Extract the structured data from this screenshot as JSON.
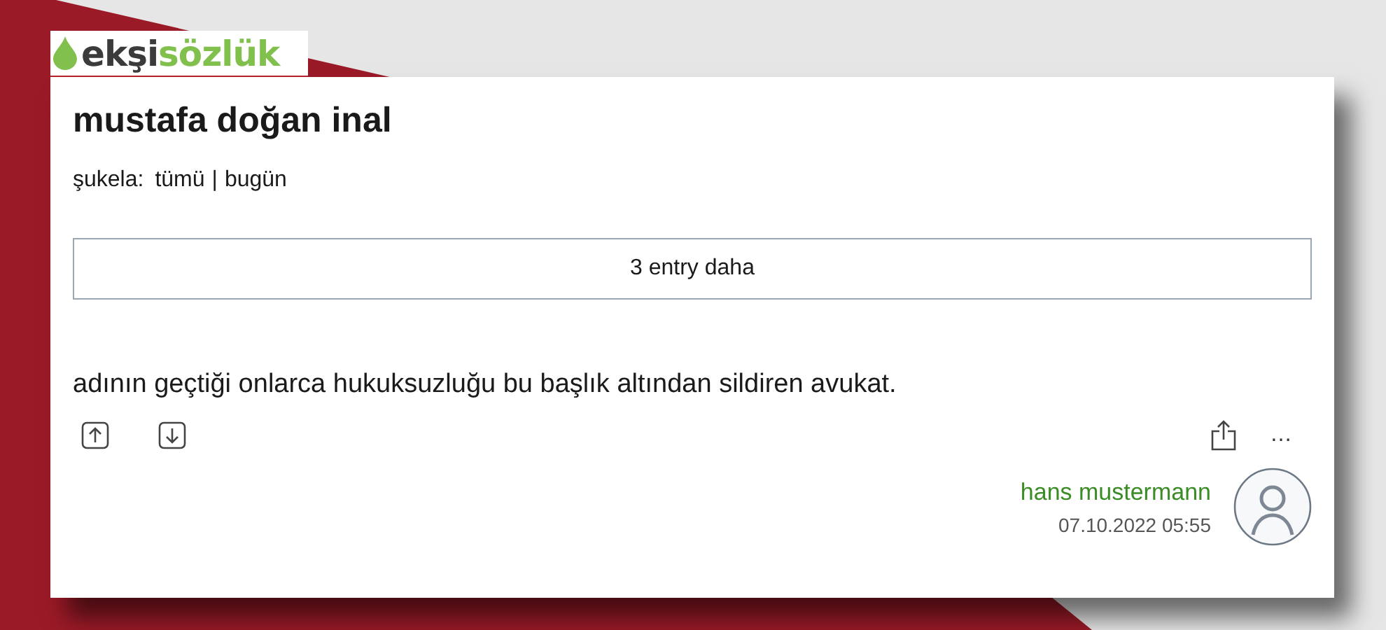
{
  "logo": {
    "dark": "ekşi",
    "green": "sözlük"
  },
  "topic": {
    "title": "mustafa doğan inal",
    "filter_label": "şukela:",
    "filters": [
      {
        "label": "tümü"
      },
      {
        "label": "bugün"
      }
    ],
    "separator": "|"
  },
  "more_button": "3 entry daha",
  "entry": {
    "text": "adının geçtiği onlarca hukuksuzluğu bu başlık altından sildiren avukat.",
    "more_menu": "…",
    "author": "hans mustermann",
    "date": "07.10.2022 05:55"
  }
}
